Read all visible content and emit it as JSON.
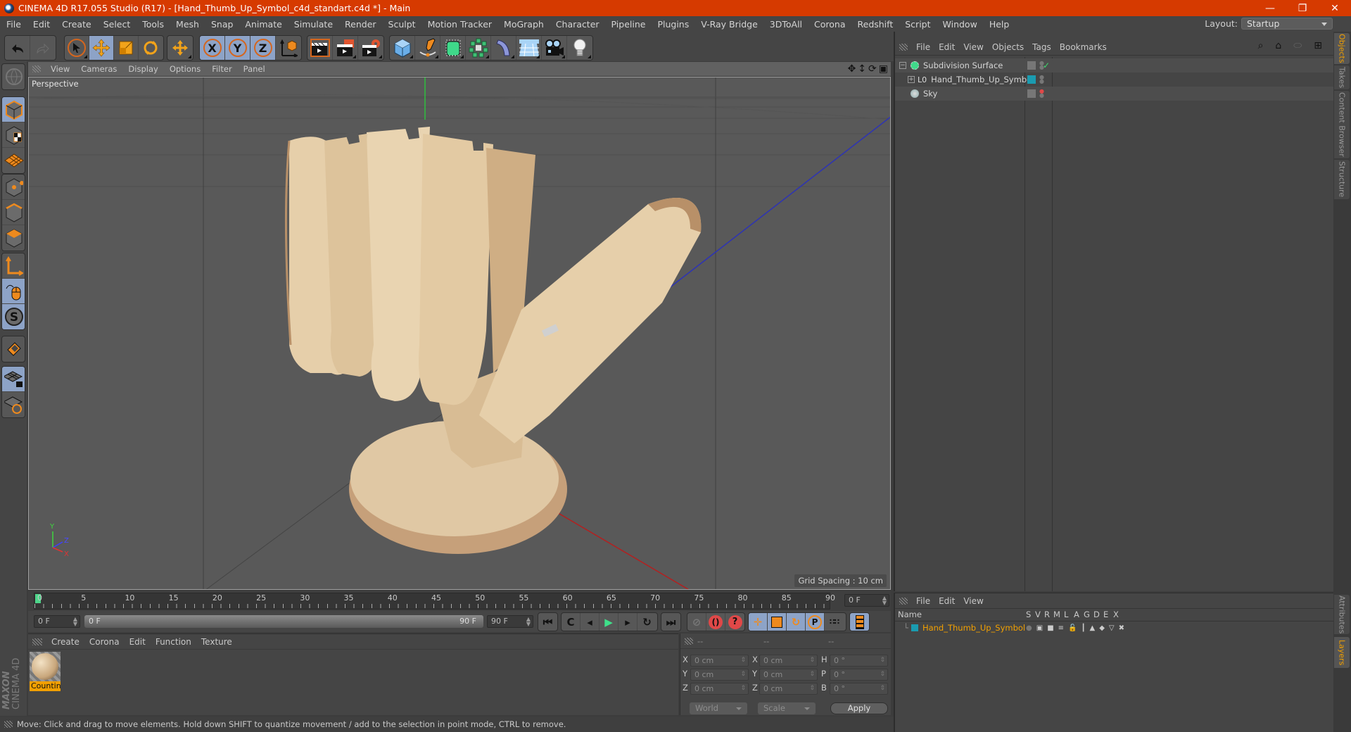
{
  "window": {
    "title": "CINEMA 4D R17.055 Studio (R17) - [Hand_Thumb_Up_Symbol_c4d_standart.c4d *] - Main",
    "controls": [
      "minimize",
      "restore",
      "close"
    ]
  },
  "menubar": {
    "items": [
      "File",
      "Edit",
      "Create",
      "Select",
      "Tools",
      "Mesh",
      "Snap",
      "Animate",
      "Simulate",
      "Render",
      "Sculpt",
      "Motion Tracker",
      "MoGraph",
      "Character",
      "Pipeline",
      "Plugins",
      "V-Ray Bridge",
      "3DToAll",
      "Corona",
      "Redshift",
      "Script",
      "Window",
      "Help"
    ],
    "layout_label": "Layout:",
    "layout_value": "Startup"
  },
  "toolbar": {
    "groups": [
      [
        "undo-icon",
        "redo-icon"
      ],
      [
        "select-arrow-icon",
        "move-icon",
        "scale-icon",
        "rotate-icon",
        "move-last-icon"
      ],
      [
        "x-axis-lock",
        "y-axis-lock",
        "z-axis-lock",
        "world-coord-icon"
      ],
      [
        "render-view-icon",
        "render-picture-viewer-icon",
        "render-settings-icon"
      ],
      [
        "cube-primitive-icon",
        "pen-spline-icon",
        "subdivision-surface-icon",
        "cloner-icon",
        "deformer-bend-icon",
        "floor-environment-icon",
        "camera-icon",
        "light-icon"
      ]
    ],
    "axis_labels": [
      "X",
      "Y",
      "Z"
    ]
  },
  "left_tools": [
    "make-editable-icon",
    "model-mode-icon",
    "texture-mode-icon",
    "workplane-icon",
    "points-mode-icon",
    "edges-mode-icon",
    "polygons-mode-icon",
    "axis-mode-icon",
    "tweak-mode-icon",
    "snap-icon",
    "magnet-icon",
    "lock-workplane-icon",
    "quantize-icon"
  ],
  "viewport": {
    "menu": [
      "View",
      "Cameras",
      "Display",
      "Options",
      "Filter",
      "Panel"
    ],
    "camera_name": "Perspective",
    "grid_spacing": "Grid Spacing : 10 cm",
    "nav_icons": [
      "pan-icon",
      "dolly-icon",
      "orbit-icon",
      "maximize-view-icon"
    ],
    "axis_gizmo": {
      "y": "Y",
      "z": "Z",
      "x": "X"
    }
  },
  "timeline": {
    "ticks": [
      "0",
      "5",
      "10",
      "15",
      "20",
      "25",
      "30",
      "35",
      "40",
      "45",
      "50",
      "55",
      "60",
      "65",
      "70",
      "75",
      "80",
      "85",
      "90"
    ],
    "current_frame": "0 F",
    "start_field": "0 F",
    "range_start": "0 F",
    "range_end": "90 F",
    "end_field": "90 F"
  },
  "playback": {
    "buttons": [
      "go-to-start-icon",
      "previous-key-icon",
      "previous-frame-icon",
      "play-icon",
      "next-frame-icon",
      "next-key-icon",
      "go-to-end-icon",
      "record-keyframes-icon",
      "autokey-icon",
      "keyframe-selection-icon",
      "key-position-icon",
      "key-scale-icon",
      "key-rotation-icon",
      "key-parameter-icon",
      "key-pla-icon",
      "timeline-icon"
    ]
  },
  "material_panel": {
    "menu": [
      "Create",
      "Corona",
      "Edit",
      "Function",
      "Texture"
    ],
    "materials": [
      {
        "name": "Countin",
        "selected": true
      }
    ]
  },
  "coord_panel": {
    "headers": [
      "--",
      "--",
      "--"
    ],
    "rows": [
      {
        "pos_label": "X",
        "pos": "0 cm",
        "size_label": "X",
        "size": "0 cm",
        "rot_label": "H",
        "rot": "0 °"
      },
      {
        "pos_label": "Y",
        "pos": "0 cm",
        "size_label": "Y",
        "size": "0 cm",
        "rot_label": "P",
        "rot": "0 °"
      },
      {
        "pos_label": "Z",
        "pos": "0 cm",
        "size_label": "Z",
        "size": "0 cm",
        "rot_label": "B",
        "rot": "0 °"
      }
    ],
    "coord_system": "World",
    "size_mode": "Scale",
    "apply_label": "Apply"
  },
  "status": {
    "text": "Move: Click and drag to move elements. Hold down SHIFT to quantize movement / add to the selection in point mode, CTRL to remove."
  },
  "objects_panel": {
    "menu": [
      "File",
      "Edit",
      "View",
      "Objects",
      "Tags",
      "Bookmarks"
    ],
    "objects": [
      {
        "name": "Subdivision Surface",
        "icon": "subdivision-icon",
        "expanded": true,
        "check": "✓"
      },
      {
        "name": "Hand_Thumb_Up_Symbol",
        "icon": "null-object-icon",
        "expanded": false,
        "tag_color": "#1a9bb0"
      },
      {
        "name": "Sky",
        "icon": "sky-icon",
        "expanded": false
      }
    ]
  },
  "layers_panel": {
    "menu": [
      "File",
      "Edit",
      "View"
    ],
    "columns": [
      "Name",
      "S",
      "V",
      "R",
      "M",
      "L",
      "A",
      "G",
      "D",
      "E",
      "X"
    ],
    "rows": [
      {
        "name": "Hand_Thumb_Up_Symbol",
        "color": "#1a9bb0"
      }
    ]
  },
  "side_tabs_top": [
    "Objects",
    "Takes",
    "Content Browser",
    "Structure"
  ],
  "side_tabs_bottom": [
    "Attributes",
    "Layers"
  ],
  "branding": {
    "maxon": "MAXON",
    "product": "CINEMA 4D"
  },
  "colors": {
    "titlebar": "#d63a00",
    "accent_orange": "#f2a000",
    "active_blue": "#8da3c7",
    "layer_teal": "#1a9bb0"
  }
}
